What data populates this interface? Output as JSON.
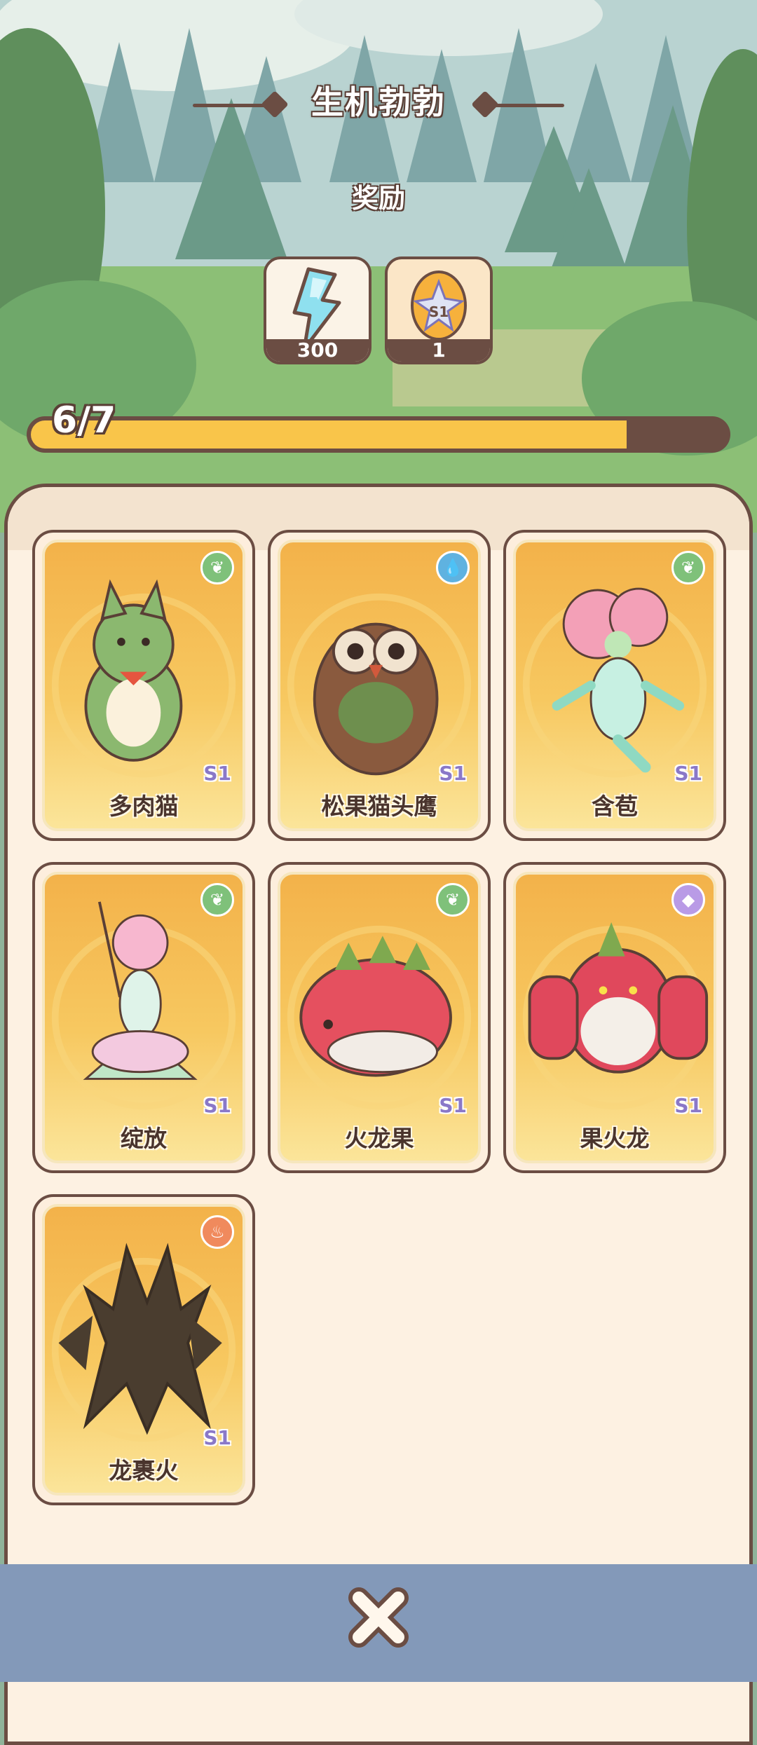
{
  "header": {
    "title": "生机勃勃",
    "reward_label": "奖励"
  },
  "rewards": [
    {
      "name": "energy-reward",
      "icon": "lightning-icon",
      "quantity": "300"
    },
    {
      "name": "egg-reward",
      "icon": "s1-egg-icon",
      "egg_label": "S1",
      "quantity": "1"
    }
  ],
  "progress": {
    "text": "6/7",
    "fraction": 0.857
  },
  "colors": {
    "grass": "#7fc17a",
    "water": "#5fb2e0",
    "dragon": "#b99be6",
    "fire": "#f08a5d",
    "bar_fill": "#f9c54a",
    "frame": "#6b4d43"
  },
  "cards": [
    {
      "name": "多肉猫",
      "season": "S1",
      "element": "grass",
      "element_icon": "leaf-icon"
    },
    {
      "name": "松果猫头鹰",
      "season": "S1",
      "element": "water",
      "element_icon": "water-drop-icon"
    },
    {
      "name": "含苞",
      "season": "S1",
      "element": "grass",
      "element_icon": "leaf-icon"
    },
    {
      "name": "绽放",
      "season": "S1",
      "element": "grass",
      "element_icon": "leaf-icon"
    },
    {
      "name": "火龙果",
      "season": "S1",
      "element": "grass",
      "element_icon": "leaf-icon"
    },
    {
      "name": "果火龙",
      "season": "S1",
      "element": "dragon",
      "element_icon": "dragon-scale-icon"
    },
    {
      "name": "龙裹火",
      "season": "S1",
      "element": "fire",
      "element_icon": "flame-icon"
    }
  ],
  "close_button": {
    "icon": "close-icon"
  }
}
